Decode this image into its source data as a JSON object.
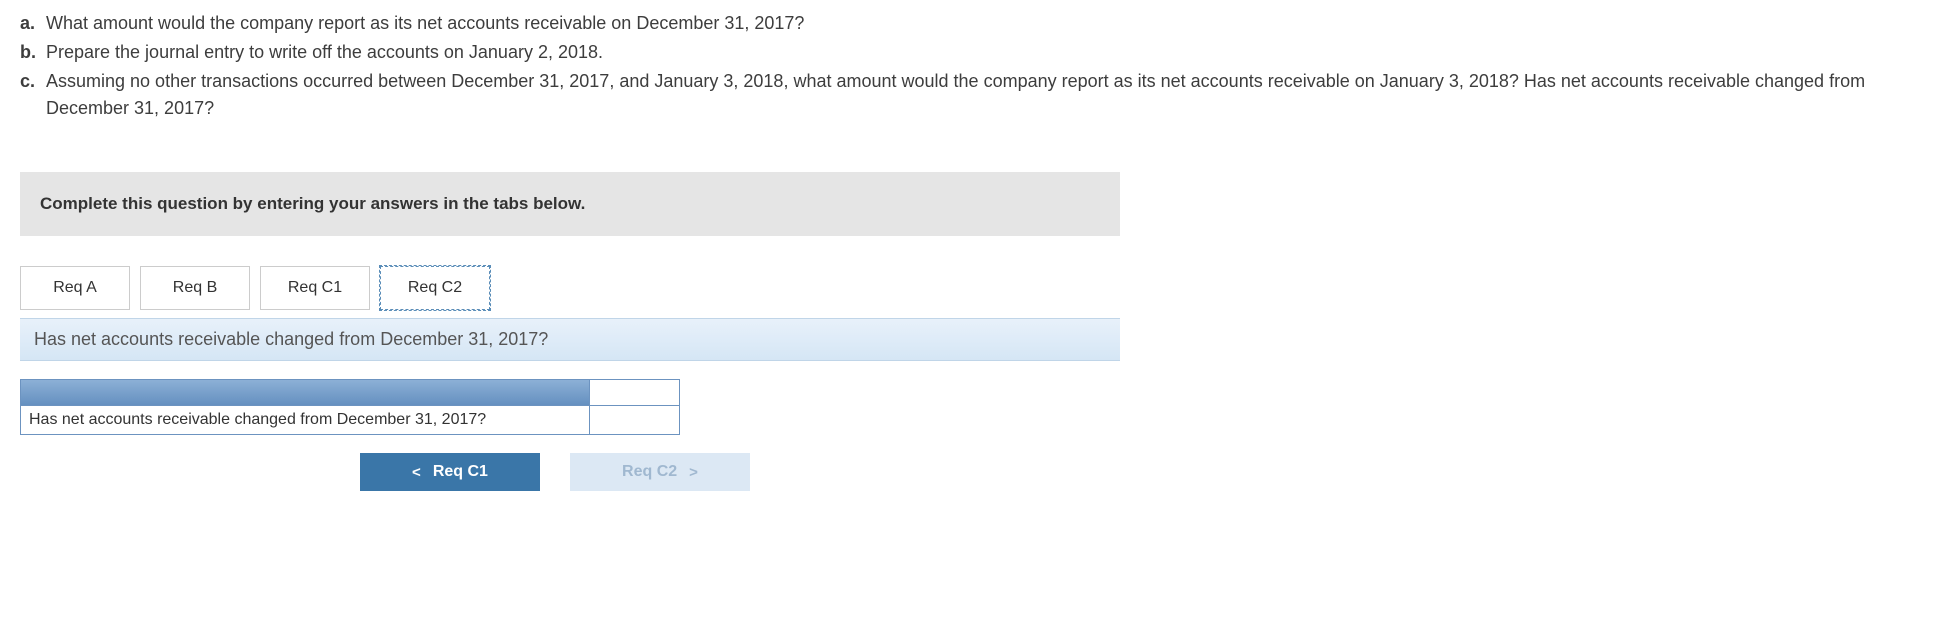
{
  "questions": [
    {
      "label": "a.",
      "text": "What amount would the company report as its net accounts receivable on December 31, 2017?"
    },
    {
      "label": "b.",
      "text": "Prepare the journal entry to write off the accounts on January 2, 2018."
    },
    {
      "label": "c.",
      "text": "Assuming no other transactions occurred between December 31, 2017, and January 3, 2018, what amount would the company report as its net accounts receivable on January 3, 2018? Has net accounts receivable changed from December 31, 2017?"
    }
  ],
  "instruction": "Complete this question by entering your answers in the tabs below.",
  "tabs": [
    {
      "label": "Req A"
    },
    {
      "label": "Req B"
    },
    {
      "label": "Req C1"
    },
    {
      "label": "Req C2"
    }
  ],
  "active_tab_index": 3,
  "prompt": "Has net accounts receivable changed from December 31, 2017?",
  "table_question": "Has net accounts receivable changed from December 31, 2017?",
  "nav": {
    "prev": "Req C1",
    "next": "Req C2"
  }
}
